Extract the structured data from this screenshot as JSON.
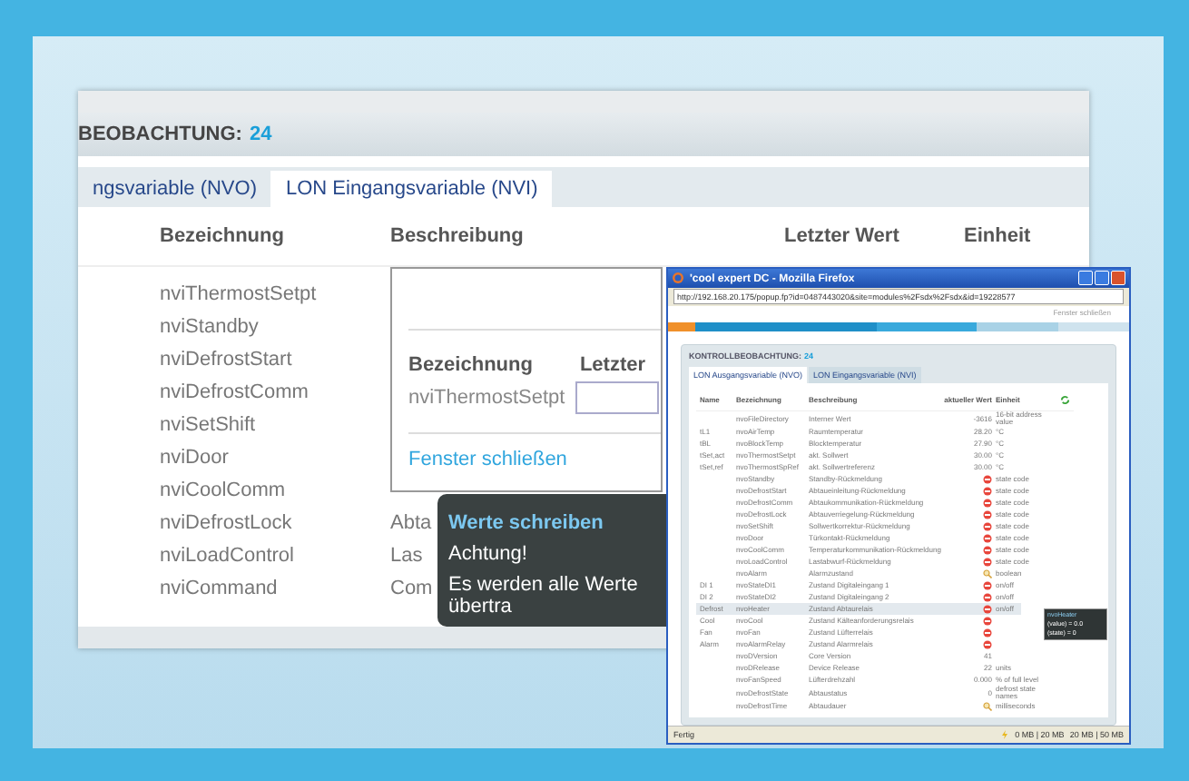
{
  "main": {
    "header": {
      "title": "BEOBACHTUNG:",
      "count": "24"
    },
    "tabs": [
      {
        "label": "ngsvariable (NVO)",
        "selected": false
      },
      {
        "label": "LON Eingangsvariable (NVI)",
        "selected": true
      }
    ],
    "columns": [
      "Bezeichnung",
      "Beschreibung",
      "Letzter Wert",
      "Einheit"
    ],
    "rows": [
      {
        "name": "nviThermostSetpt",
        "description": ""
      },
      {
        "name": "nviStandby",
        "description": ""
      },
      {
        "name": "nviDefrostStart",
        "description": ""
      },
      {
        "name": "nviDefrostComm",
        "description": ""
      },
      {
        "name": "nviSetShift",
        "description": ""
      },
      {
        "name": "nviDoor",
        "description": ""
      },
      {
        "name": "nviCoolComm",
        "description": ""
      },
      {
        "name": "nviDefrostLock",
        "description": "Abta"
      },
      {
        "name": "nviLoadControl",
        "description": "Las"
      },
      {
        "name": "nviCommand",
        "description": "Com"
      }
    ],
    "dialog": {
      "columns": [
        "Bezeichnung",
        "Letzter"
      ],
      "row_name": "nviThermostSetpt",
      "close_link": "Fenster schließen"
    },
    "tooltip": {
      "title": "Werte schreiben",
      "lines": [
        "Achtung!",
        "Es werden alle Werte übertra"
      ]
    }
  },
  "popup": {
    "window": {
      "title": "'cool expert DC - Mozilla Firefox"
    },
    "url": "http://192.168.20.175/popup.fp?id=0487443020&site=modules%2Fsdx%2Fsdx&id=19228577",
    "close_link": "Fenster schließen",
    "header": {
      "title": "KONTROLLBEOBACHTUNG:",
      "count": "24"
    },
    "tabs": [
      {
        "label": "LON Ausgangsvariable (NVO)",
        "selected": true
      },
      {
        "label": "LON Eingangsvariable (NVI)",
        "selected": false
      }
    ],
    "columns": [
      "Name",
      "Bezeichnung",
      "Beschreibung",
      "aktueller Wert",
      "Einheit"
    ],
    "rows": [
      {
        "name": "",
        "label": "nvoFileDirectory",
        "description": "Interner Wert",
        "kind": "text",
        "value": "-3616",
        "unit": "16-bit address value",
        "selected": false
      },
      {
        "name": "tL1",
        "label": "nvoAirTemp",
        "description": "Raumtemperatur",
        "kind": "text",
        "value": "28.20",
        "unit": "°C",
        "selected": false
      },
      {
        "name": "tBL",
        "label": "nvoBlockTemp",
        "description": "Blocktemperatur",
        "kind": "text",
        "value": "27.90",
        "unit": "°C",
        "selected": false
      },
      {
        "name": "tSet,act",
        "label": "nvoThermostSetpt",
        "description": "akt. Sollwert",
        "kind": "text",
        "value": "30.00",
        "unit": "°C",
        "selected": false
      },
      {
        "name": "tSet,ref",
        "label": "nvoThermostSpRef",
        "description": "akt. Sollwertreferenz",
        "kind": "text",
        "value": "30.00",
        "unit": "°C",
        "selected": false
      },
      {
        "name": "",
        "label": "nvoStandby",
        "description": "Standby-Rückmeldung",
        "kind": "alert",
        "value": "",
        "unit": "state code",
        "selected": false
      },
      {
        "name": "",
        "label": "nvoDefrostStart",
        "description": "Abtaueinleitung-Rückmeldung",
        "kind": "alert",
        "value": "",
        "unit": "state code",
        "selected": false
      },
      {
        "name": "",
        "label": "nvoDefrostComm",
        "description": "Abtaukommunikation-Rückmeldung",
        "kind": "alert",
        "value": "",
        "unit": "state code",
        "selected": false
      },
      {
        "name": "",
        "label": "nvoDefrostLock",
        "description": "Abtauverriegelung-Rückmeldung",
        "kind": "alert",
        "value": "",
        "unit": "state code",
        "selected": false
      },
      {
        "name": "",
        "label": "nvoSetShift",
        "description": "Sollwertkorrektur-Rückmeldung",
        "kind": "alert",
        "value": "",
        "unit": "state code",
        "selected": false
      },
      {
        "name": "",
        "label": "nvoDoor",
        "description": "Türkontakt-Rückmeldung",
        "kind": "alert",
        "value": "",
        "unit": "state code",
        "selected": false
      },
      {
        "name": "",
        "label": "nvoCoolComm",
        "description": "Temperaturkommunikation-Rückmeldung",
        "kind": "alert",
        "value": "",
        "unit": "state code",
        "selected": false
      },
      {
        "name": "",
        "label": "nvoLoadControl",
        "description": "Lastabwurf-Rückmeldung",
        "kind": "alert",
        "value": "",
        "unit": "state code",
        "selected": false
      },
      {
        "name": "",
        "label": "nvoAlarm",
        "description": "Alarmzustand",
        "kind": "search",
        "value": "",
        "unit": "boolean",
        "selected": false
      },
      {
        "name": "DI 1",
        "label": "nvoStateDI1",
        "description": "Zustand Digitaleingang 1",
        "kind": "alert",
        "value": "",
        "unit": "on/off",
        "selected": false
      },
      {
        "name": "DI 2",
        "label": "nvoStateDI2",
        "description": "Zustand Digitaleingang 2",
        "kind": "alert",
        "value": "",
        "unit": "on/off",
        "selected": false
      },
      {
        "name": "Defrost",
        "label": "nvoHeater",
        "description": "Zustand Abtaurelais",
        "kind": "alert",
        "value": "",
        "unit": "on/off",
        "selected": true
      },
      {
        "name": "Cool",
        "label": "nvoCool",
        "description": "Zustand Kälteanforderungsrelais",
        "kind": "alert",
        "value": "",
        "unit": "",
        "selected": false
      },
      {
        "name": "Fan",
        "label": "nvoFan",
        "description": "Zustand Lüfterrelais",
        "kind": "alert",
        "value": "",
        "unit": "",
        "selected": false
      },
      {
        "name": "Alarm",
        "label": "nvoAlarmRelay",
        "description": "Zustand Alarmrelais",
        "kind": "alert",
        "value": "",
        "unit": "",
        "selected": false
      },
      {
        "name": "",
        "label": "nvoDVersion",
        "description": "Core Version",
        "kind": "text",
        "value": "41",
        "unit": "",
        "selected": false
      },
      {
        "name": "",
        "label": "nvoDRelease",
        "description": "Device Release",
        "kind": "text",
        "value": "22",
        "unit": "units",
        "selected": false
      },
      {
        "name": "",
        "label": "nvoFanSpeed",
        "description": "Lüfterdrehzahl",
        "kind": "text",
        "value": "0.000",
        "unit": "% of full level",
        "selected": false
      },
      {
        "name": "",
        "label": "nvoDefrostState",
        "description": "Abtaustatus",
        "kind": "text",
        "value": "0",
        "unit": "defrost state names",
        "selected": false
      },
      {
        "name": "",
        "label": "nvoDefrostTime",
        "description": "Abtaudauer",
        "kind": "search",
        "value": "",
        "unit": "milliseconds",
        "selected": false
      }
    ],
    "tooltip": {
      "title": "nvoHeater",
      "lines": [
        "(value) = 0.0",
        "(state) = 0"
      ]
    },
    "status_bar": {
      "text": "Fertig",
      "memory_1": "0 MB | 20 MB",
      "memory_2": "20 MB | 50 MB"
    }
  }
}
